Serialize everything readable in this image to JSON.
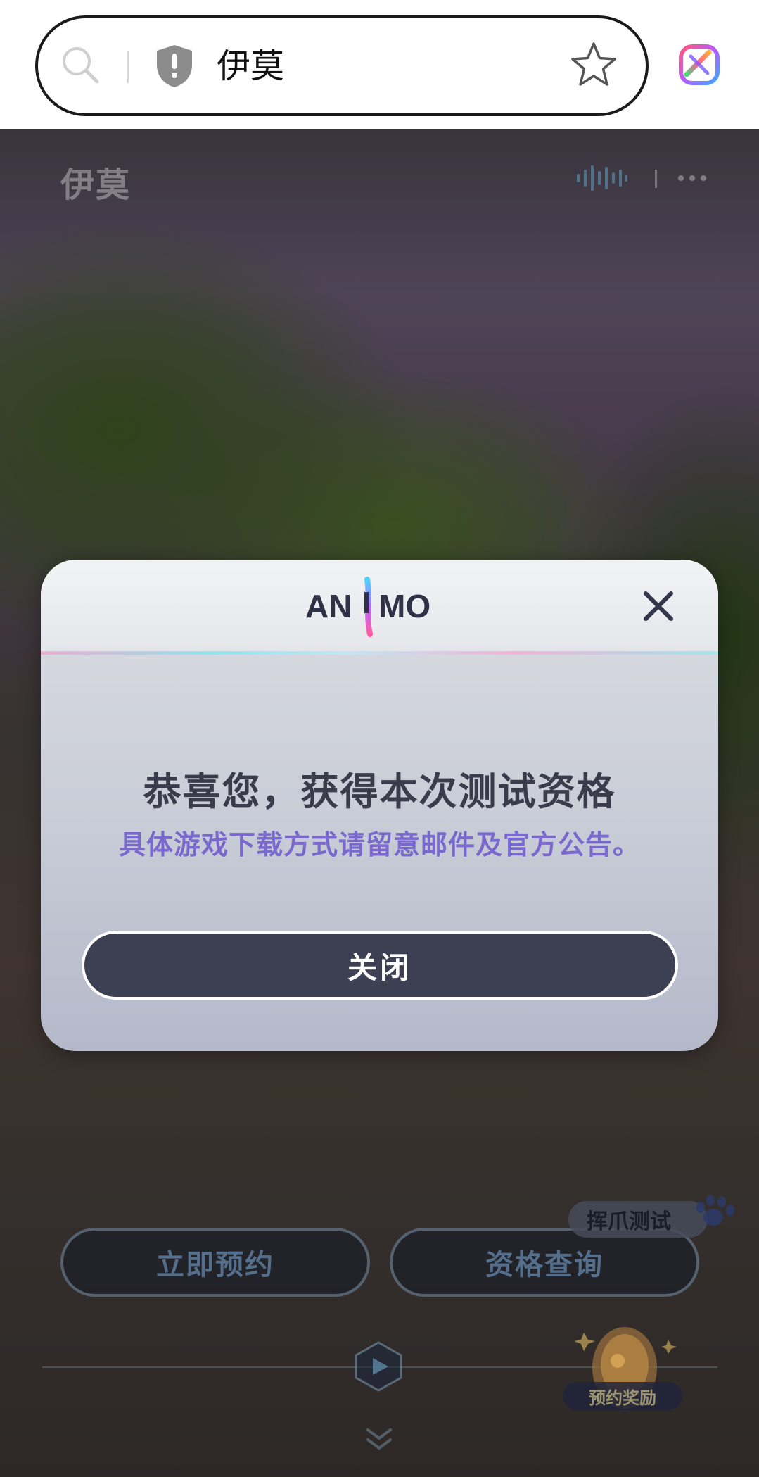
{
  "browser": {
    "url_text": "伊莫",
    "icons": [
      "search-icon",
      "shield-icon",
      "star-icon",
      "browser-logo-icon"
    ]
  },
  "page": {
    "site_logo": "伊莫",
    "header_icons": [
      "audio-icon",
      "more-icon"
    ],
    "buttons": {
      "reserve": "立即预约",
      "check": "资格查询"
    },
    "test_badge": "挥爪测试",
    "reward_label": "预约奖励"
  },
  "modal": {
    "logo_text": "ANiMO",
    "title": "恭喜您，获得本次测试资格",
    "subtitle": "具体游戏下载方式请留意邮件及官方公告。",
    "close_button": "关闭",
    "colors": {
      "title": "#3a3c4c",
      "subtitle": "#7a68cf",
      "button_bg": "#3d3f52"
    }
  }
}
